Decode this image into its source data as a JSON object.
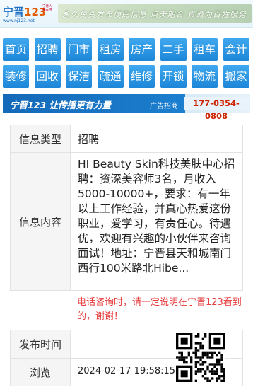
{
  "header": {
    "logo_brand": "宁晋",
    "logo_number": "123",
    "logo_slogan": "宁晋人 都去用",
    "logo_domain": "www.nj123.net",
    "banner_text": "永久免费发布便民信息  点天期合  真诚为百姓服务"
  },
  "nav": {
    "row1": [
      "首页",
      "招聘",
      "门市",
      "租房",
      "房产",
      "二手",
      "租车",
      "会计"
    ],
    "row2": [
      "装修",
      "回收",
      "保洁",
      "疏通",
      "维修",
      "开锁",
      "物流",
      "搬家"
    ]
  },
  "ad": {
    "slogan": "宁晋123 让传播更有力量",
    "tag": "广告招商",
    "phone": "177-0354-0808"
  },
  "detail": {
    "type_label": "信息类型",
    "type_value": "招聘",
    "content_label": "信息内容",
    "content_value": "HI Beauty Skin科技美肤中心招聘：资深美容师3名，月收入5000-10000+，要求：有一年以上工作经验，并真心热爱这份职业，爱学习，有责任心。待遇优，欢迎有兴趣的小伙伴来咨询面试！地址：宁晋县天和城南门西行100米路北Hibe...",
    "tip": "电话咨询时，请一定说明在宁晋123看到的，谢谢！",
    "publish_label": "发布时间",
    "publish_value": "2024-02-17 19:58:15",
    "views_label": "浏览"
  },
  "colors": {
    "nav_blue": "#1d86d8",
    "tip_red": "#e73b3b",
    "brand_blue": "#1e6fc2"
  }
}
